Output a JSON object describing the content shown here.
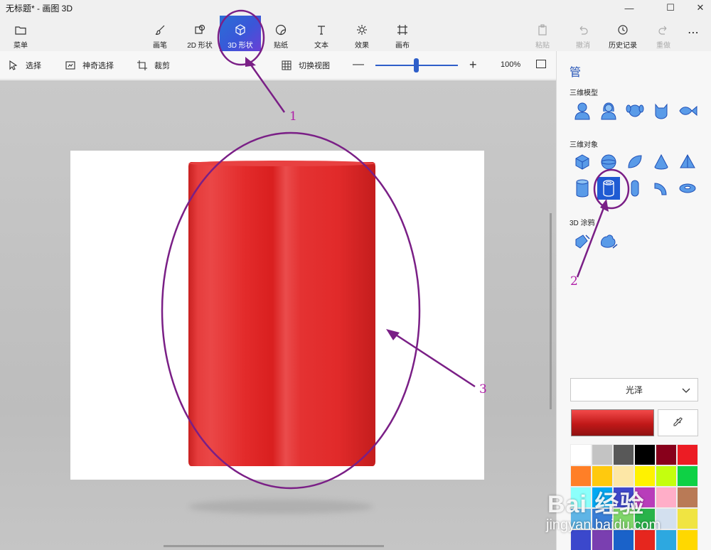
{
  "window": {
    "title": "无标题* - 画图 3D"
  },
  "ribbon": {
    "menu": "菜单",
    "tools": [
      {
        "label": "画笔",
        "icon": "brush-icon"
      },
      {
        "label": "2D 形状",
        "icon": "2d-shapes-icon"
      },
      {
        "label": "3D 形状",
        "icon": "3d-shapes-icon",
        "active": true
      },
      {
        "label": "贴纸",
        "icon": "stickers-icon"
      },
      {
        "label": "文本",
        "icon": "text-icon"
      },
      {
        "label": "效果",
        "icon": "effects-icon"
      },
      {
        "label": "画布",
        "icon": "canvas-icon"
      }
    ],
    "right": [
      {
        "label": "粘贴",
        "disabled": true
      },
      {
        "label": "撤消",
        "disabled": true
      },
      {
        "label": "历史记录",
        "disabled": false
      },
      {
        "label": "重做",
        "disabled": true
      }
    ]
  },
  "toolbar": {
    "select": "选择",
    "magic_select": "神奇选择",
    "crop": "裁剪",
    "toggle_view": "切换视图",
    "zoom_value": "100%",
    "zoom_minus": "—",
    "zoom_plus": "+"
  },
  "panel": {
    "title": "管",
    "models_label": "三维模型",
    "objects_label": "三维对象",
    "doodle_label": "3D 涂鸦",
    "material": "光泽",
    "current_color": "#d82424",
    "palette": [
      "#ffffff",
      "#c3c3c3",
      "#585858",
      "#000000",
      "#88001b",
      "#ec1c24",
      "#ff7f27",
      "#ffc90e",
      "#fde7a6",
      "#fff200",
      "#c4ff0e",
      "#0ed145",
      "#8cfffb",
      "#00a8f3",
      "#3f48cc",
      "#b83dba",
      "#ffaec8",
      "#b97a56",
      "#5fb5e6",
      "#3a7fd6",
      "#7fd66a",
      "#29b34a",
      "#d3e0ef",
      "#f0e442",
      "#3b48cc",
      "#7a3fb0",
      "#1a62c9",
      "#e6261e",
      "#2da8e0",
      "#ffd800"
    ]
  },
  "annotations": {
    "n1": "1",
    "n2": "2",
    "n3": "3"
  },
  "watermark": {
    "brand": "Bai 经验",
    "url": "jingyan.baidu.com"
  }
}
